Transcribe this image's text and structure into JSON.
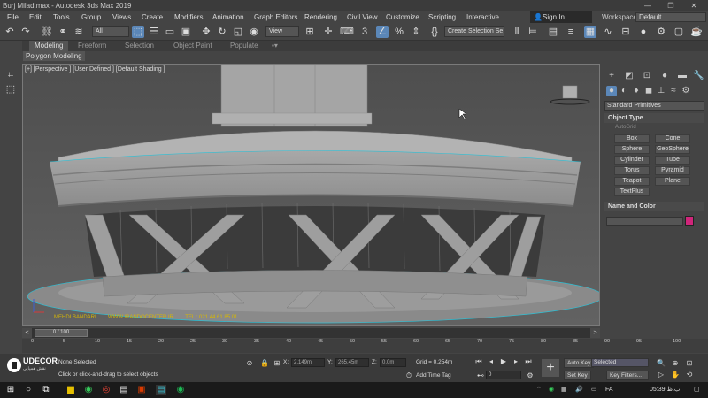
{
  "window": {
    "title": "Burj Milad.max - Autodesk 3ds Max 2019",
    "buttons": {
      "minimize": "—",
      "maximize": "❐",
      "close": "✕"
    }
  },
  "menubar": {
    "items": [
      "File",
      "Edit",
      "Tools",
      "Group",
      "Views",
      "Create",
      "Modifiers",
      "Animation",
      "Graph Editors",
      "Rendering",
      "Civil View",
      "Customize",
      "Scripting",
      "Interactive"
    ],
    "sign_in": "Sign In",
    "workspaces_label": "Workspaces:",
    "workspace_value": "Default"
  },
  "toolbar": {
    "filter_value": "All",
    "view_value": "View",
    "selection_set_placeholder": "Create Selection Se"
  },
  "ribbon": {
    "tabs": [
      "Modeling",
      "Freeform",
      "Selection",
      "Object Paint",
      "Populate"
    ],
    "active_tab": "Polygon Modeling"
  },
  "viewport": {
    "label": "[+] [Perspective ] [User Defined ] [Default Shading ]",
    "watermark": "MEHDI BANDARI ...... WWW.IRANDOCENTER.IR ...... TEL : 021 44 61 85 01"
  },
  "command_panel": {
    "category_value": "Standard Primitives",
    "object_type_title": "Object Type",
    "autogrid_label": "AutoGrid",
    "primitives": [
      "Box",
      "Cone",
      "Sphere",
      "GeoSphere",
      "Cylinder",
      "Tube",
      "Torus",
      "Pyramid",
      "Teapot",
      "Plane",
      "TextPlus"
    ],
    "name_color_title": "Name and Color",
    "object_color": "#d0257a"
  },
  "timeline": {
    "frame_display": "0 / 100",
    "ticks": [
      "0",
      "5",
      "10",
      "15",
      "20",
      "25",
      "30",
      "35",
      "40",
      "45",
      "50",
      "55",
      "60",
      "65",
      "70",
      "75",
      "80",
      "85",
      "90",
      "95",
      "100"
    ]
  },
  "status": {
    "selection_text": "None Selected",
    "prompt_text": "Click or click-and-drag to select objects",
    "x_label": "X:",
    "x_value": "2.149m",
    "y_label": "Y:",
    "y_value": "265.45m",
    "z_label": "Z:",
    "z_value": "0.0m",
    "grid_text": "Grid = 0.254m",
    "add_time_tag": "Add Time Tag",
    "auto_key": "Auto Key",
    "set_key": "Set Key",
    "selected_value": "Selected",
    "key_filters": "Key Filters...",
    "frame_value": "0",
    "logo_text": "UDECOR",
    "logo_sub": "نقش همپایی"
  },
  "taskbar": {
    "time": "05:39 ب.ظ",
    "lang": "FA"
  }
}
